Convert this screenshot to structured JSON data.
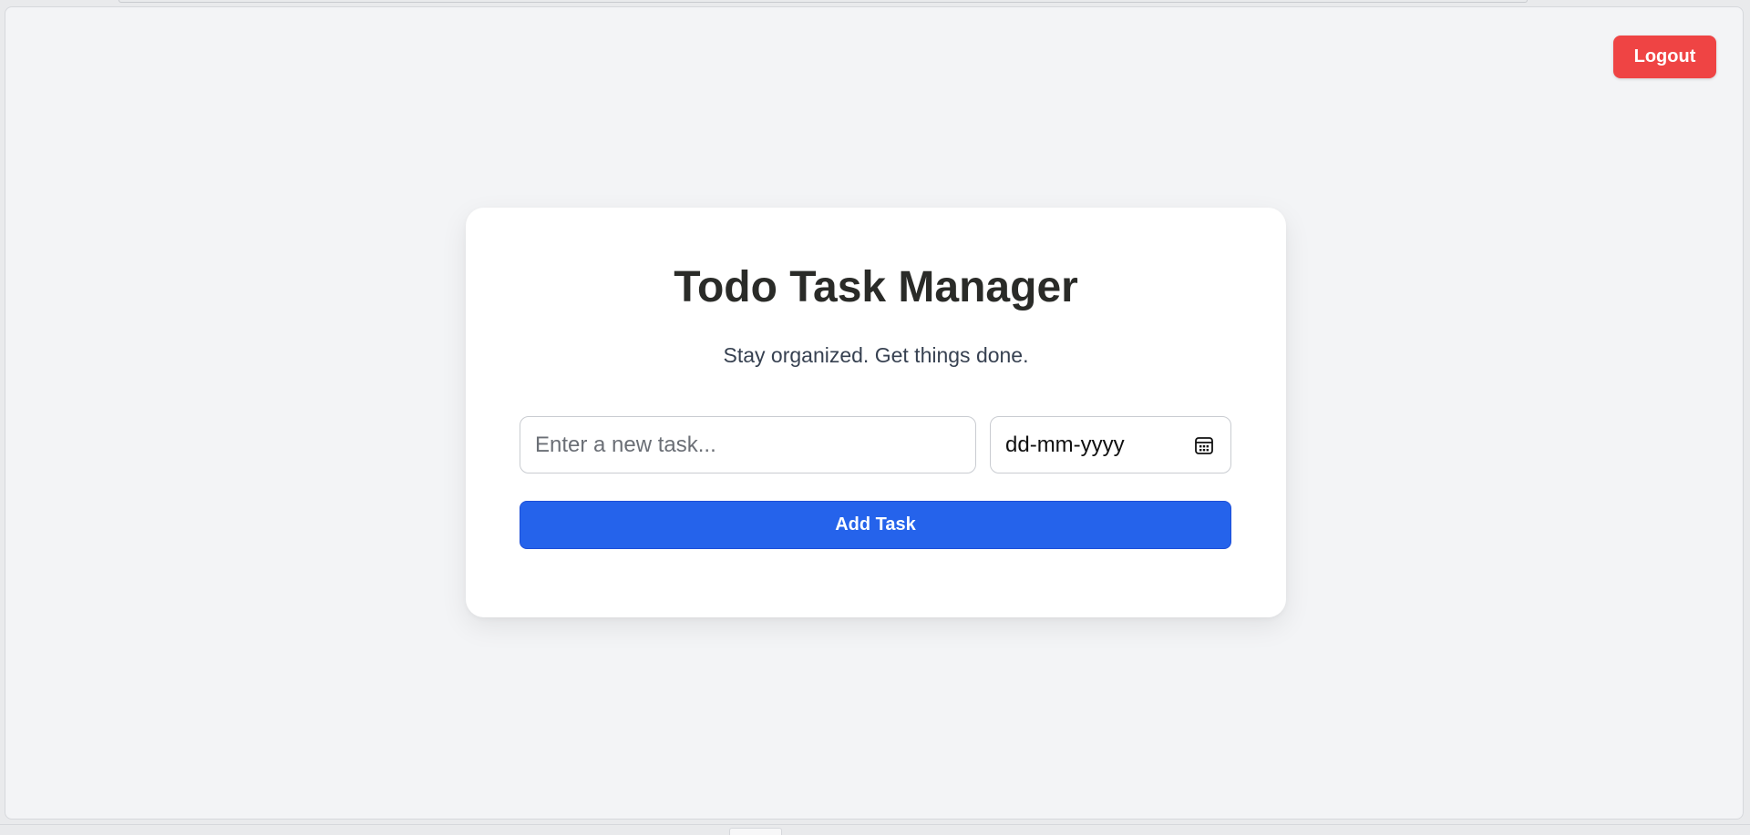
{
  "header": {
    "logout_label": "Logout"
  },
  "card": {
    "title": "Todo Task Manager",
    "subtitle": "Stay organized. Get things done."
  },
  "form": {
    "task_input": {
      "placeholder": "Enter a new task...",
      "value": ""
    },
    "date_input": {
      "display": "dd-mm-yyyy",
      "icon": "calendar-icon"
    },
    "add_button_label": "Add Task"
  },
  "colors": {
    "page_background": "#f3f4f6",
    "card_background": "#ffffff",
    "logout_red": "#ef4444",
    "primary_blue": "#2563eb",
    "title_text": "#2a2b28",
    "subtitle_text": "#374151"
  }
}
